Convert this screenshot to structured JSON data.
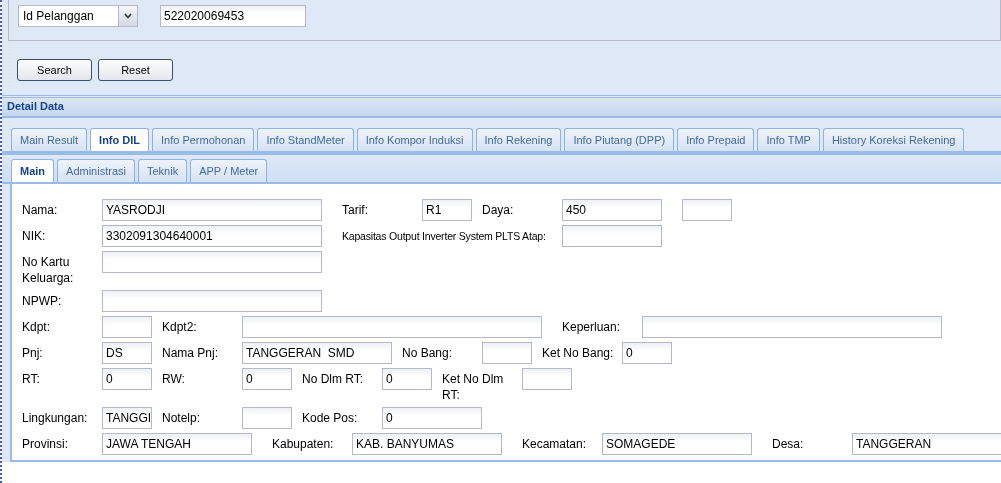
{
  "search": {
    "field_type": "Id Pelanggan",
    "value": "522020069453"
  },
  "buttons": [
    "Search",
    "Reset"
  ],
  "detail_title": "Detail Data",
  "tabs": [
    {
      "label": "Main Result",
      "selected": false
    },
    {
      "label": "Info DIL",
      "selected": true
    },
    {
      "label": "Info Permohonan",
      "selected": false
    },
    {
      "label": "Info StandMeter",
      "selected": false
    },
    {
      "label": "Info Kompor Induksi",
      "selected": false
    },
    {
      "label": "Info Rekening",
      "selected": false
    },
    {
      "label": "Info Piutang (DPP)",
      "selected": false
    },
    {
      "label": "Info Prepaid",
      "selected": false
    },
    {
      "label": "Info TMP",
      "selected": false
    },
    {
      "label": "History Koreksi Rekening",
      "selected": false
    }
  ],
  "subtabs": [
    {
      "label": "Main",
      "selected": true
    },
    {
      "label": "Administrasi",
      "selected": false
    },
    {
      "label": "Teknik",
      "selected": false
    },
    {
      "label": "APP / Meter",
      "selected": false
    }
  ],
  "form_rows": [
    [
      {
        "label": "Nama:",
        "value": "YASRODJI"
      },
      {
        "label": "Tarif:",
        "value": "R1"
      },
      {
        "label": "Daya:",
        "value": "450"
      },
      {}
    ],
    [
      {
        "label": "NIK:",
        "value": "3302091304640001"
      },
      {
        "label": "Kapasitas Output Inverter System PLTS Atap:"
      }
    ],
    [
      {
        "label": "No Kartu Keluarga:"
      }
    ],
    [
      {
        "label": "NPWP:"
      }
    ],
    [
      {
        "label": "Kdpt:"
      },
      {
        "label": "Kdpt2:"
      },
      {
        "label": "Keperluan:"
      }
    ],
    [
      {
        "label": "Pnj:",
        "value": "DS"
      },
      {
        "label": "Nama Pnj:",
        "value": "TANGGERAN  SMD"
      },
      {
        "label": "No Bang:"
      },
      {
        "label": "Ket No Bang:",
        "value": "0"
      }
    ],
    [
      {
        "label": "RT:",
        "value": "0"
      },
      {
        "label": "RW:",
        "value": "0"
      },
      {
        "label": "No Dlm RT:",
        "value": "0"
      },
      {
        "label": "Ket No Dlm RT:"
      }
    ],
    [
      {
        "label": "Lingkungan:",
        "value": "TANGGI"
      },
      {
        "label": "Notelp:"
      },
      {
        "label": "Kode Pos:",
        "value": "0"
      }
    ],
    [
      {
        "label": "Provinsi:",
        "value": "JAWA TENGAH"
      },
      {
        "label": "Kabupaten:",
        "value": "KAB. BANYUMAS"
      },
      {
        "label": "Kecamatan:",
        "value": "SOMAGEDE"
      },
      {
        "label": "Desa:",
        "value": "TANGGERAN"
      }
    ]
  ]
}
